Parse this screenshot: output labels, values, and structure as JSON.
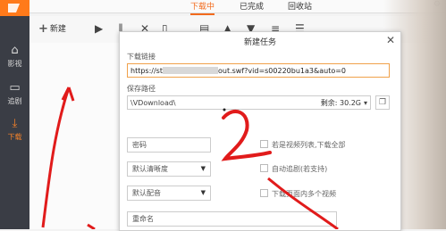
{
  "top_tabs": [
    {
      "label": "下载中",
      "active": true
    },
    {
      "label": "已完成",
      "active": false
    },
    {
      "label": "回收站",
      "active": false
    }
  ],
  "top_right": "⚙",
  "sidebar": [
    {
      "icon": "home-icon",
      "label": "影视"
    },
    {
      "icon": "tv-icon",
      "label": "追剧"
    },
    {
      "icon": "download-icon",
      "label": "下载",
      "active": true
    }
  ],
  "toolbar": {
    "new_label": "新建"
  },
  "dialog": {
    "title": "新建任务",
    "url_label": "下载链接",
    "url_prefix": "https://st",
    "url_suffix": "out.swf?vid=s00220bu1a3&auto=0",
    "path_label": "保存路径",
    "path_value": "\\VDownload\\",
    "free_label": "剩余:",
    "free_value": "30.2G",
    "password_placeholder": "密码",
    "quality_value": "默认清晰度",
    "dub_value": "默认配音",
    "rename_placeholder": "重命名",
    "opt_list": "若是视频列表,下载全部",
    "opt_autoplay": "自动追剧(若支持)",
    "opt_page": "下载页面内多个视频"
  },
  "colors": {
    "accent": "#f26b1d",
    "annotation": "#e11b1b"
  }
}
